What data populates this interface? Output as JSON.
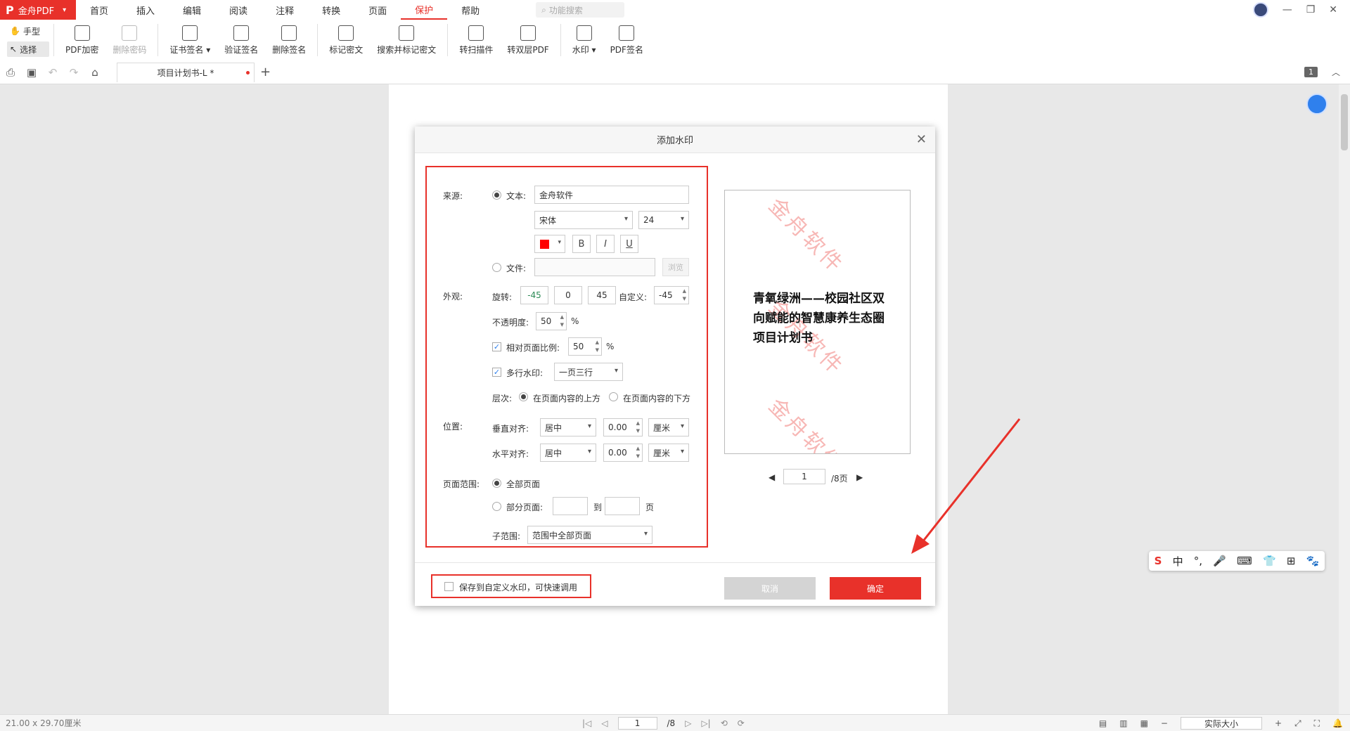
{
  "app": {
    "name": "金舟PDF"
  },
  "menu": [
    "首页",
    "插入",
    "编辑",
    "阅读",
    "注释",
    "转换",
    "页面",
    "保护",
    "帮助"
  ],
  "menu_active": "保护",
  "search_placeholder": "功能搜索",
  "ribbon": {
    "hand": "手型",
    "select": "选择",
    "buttons": [
      {
        "label": "PDF加密",
        "disabled": false
      },
      {
        "label": "删除密码",
        "disabled": true
      },
      {
        "label": "证书签名 ▾",
        "disabled": false
      },
      {
        "label": "验证签名",
        "disabled": false
      },
      {
        "label": "删除签名",
        "disabled": false
      },
      {
        "label": "标记密文",
        "disabled": false
      },
      {
        "label": "搜索并标记密文",
        "disabled": false
      },
      {
        "label": "转扫描件",
        "disabled": false
      },
      {
        "label": "转双层PDF",
        "disabled": false
      },
      {
        "label": "水印 ▾",
        "disabled": false
      },
      {
        "label": "PDF签名",
        "disabled": false
      }
    ]
  },
  "tab": {
    "title": "项目计划书-L *",
    "page_count": "1"
  },
  "dialog": {
    "title": "添加水印",
    "source_label": "来源:",
    "text_radio": "文本:",
    "text_value": "金舟软件",
    "font": "宋体",
    "size": "24",
    "bold": "B",
    "italic": "I",
    "underline": "U",
    "file_radio": "文件:",
    "browse": "浏览",
    "appearance_label": "外观:",
    "rotate_label": "旋转:",
    "rotate_options": [
      "-45",
      "0",
      "45"
    ],
    "custom_label": "自定义:",
    "custom_value": "-45",
    "opacity_label": "不透明度:",
    "opacity_value": "50",
    "percent": "%",
    "relative_label": "相对页面比例:",
    "relative_value": "50",
    "multiline_label": "多行水印:",
    "multiline_value": "一页三行",
    "layer_label": "层次:",
    "layer_above": "在页面内容的上方",
    "layer_below": "在页面内容的下方",
    "position_label": "位置:",
    "valign_label": "垂直对齐:",
    "valign_value": "居中",
    "valign_offset": "0.00",
    "halign_label": "水平对齐:",
    "halign_value": "居中",
    "halign_offset": "0.00",
    "unit": "厘米",
    "range_label": "页面范围:",
    "all_pages": "全部页面",
    "part_pages": "部分页面:",
    "to": "到",
    "page_unit": "页",
    "subrange_label": "子范围:",
    "subrange_value": "范围中全部页面",
    "preview_watermark": "金舟软件",
    "preview_title": "青氧绿洲——校园社区双向赋能的智慧康养生态圈项目计划书",
    "preview_page": "1",
    "preview_total": "/8页",
    "save_custom": "保存到自定义水印，可快速调用",
    "cancel": "取消",
    "ok": "确定"
  },
  "ime": [
    "S",
    "中",
    "°,",
    "🎤",
    "⌨",
    "👕",
    "⊞",
    "🐾"
  ],
  "status": {
    "dimensions": "21.00 x 29.70厘米",
    "page": "1",
    "total": "/8",
    "zoom": "实际大小"
  },
  "colors": {
    "accent": "#e8312a",
    "watermark_color": "#ff0000"
  }
}
